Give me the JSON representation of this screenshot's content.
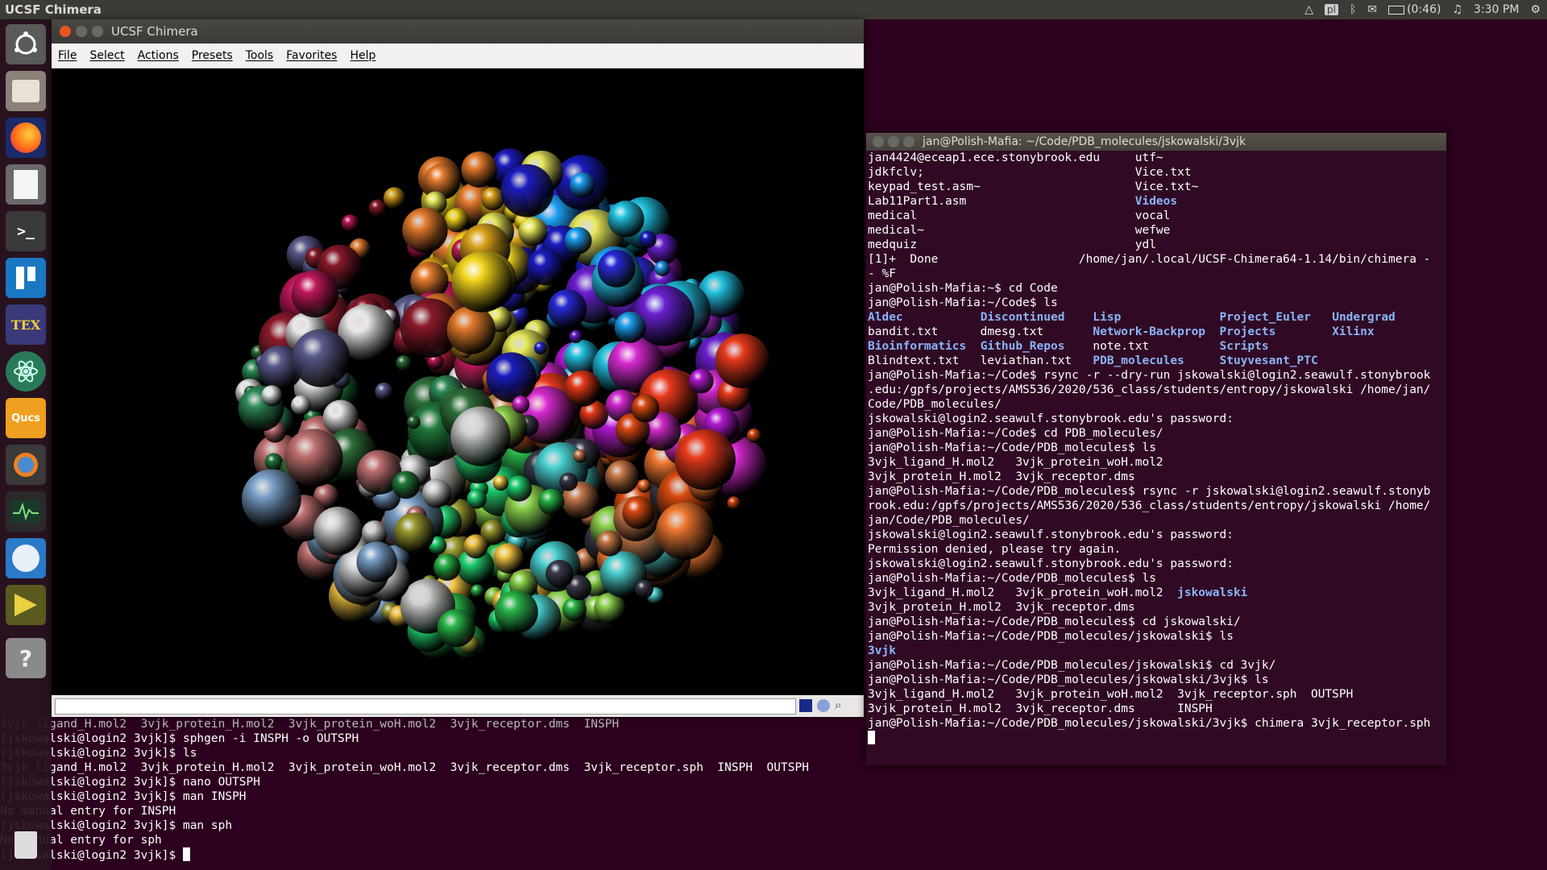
{
  "top_panel": {
    "title": "UCSF Chimera",
    "battery": "(0:46)",
    "clock": "3:30 PM"
  },
  "launcher": {
    "items": [
      "Ubuntu Dash",
      "Files",
      "Firefox",
      "Text Editor",
      "Terminal",
      "Trello",
      "TeXstudio",
      "Atom",
      "Qucs",
      "Blender",
      "System Monitor",
      "Arduino",
      "Xilinx",
      "Help",
      "Trash"
    ],
    "qucs_label": "Qucs",
    "tex_label": "TEX"
  },
  "chimera": {
    "title": "UCSF Chimera",
    "menu": [
      "File",
      "Select",
      "Actions",
      "Presets",
      "Tools",
      "Favorites",
      "Help"
    ],
    "sphere_colors": [
      "#1f7a3a",
      "#2e8b57",
      "#2f6f3a",
      "#e8e8e8",
      "#5a5a8c",
      "#8b1a2a",
      "#c0185a",
      "#e57c2e",
      "#d9a21b",
      "#f2d51d",
      "#e8e85a",
      "#1c1cc0",
      "#2a2ad8",
      "#1da1f2",
      "#22c3e0",
      "#6a1fd0",
      "#b51ad6",
      "#d62ad0",
      "#e83a1a",
      "#d84a10",
      "#f07830",
      "#c97a4a",
      "#3a3a4a",
      "#4ad1d1",
      "#8cd14a",
      "#2ab84a",
      "#20d070",
      "#f5c542",
      "#9a9a30",
      "#d0d0d0",
      "#7aa0c8",
      "#c07070"
    ]
  },
  "bg_terminal": {
    "lines": [
      "[jskowalski@login2 3vjk]$ sphgen -i INSPH -o OUTSPH",
      "[jskowalski@login2 3vjk]$ ls",
      "3vjk_ligand_H.mol2  3vjk_protein_H.mol2  3vjk_protein_woH.mol2  3vjk_receptor.dms  3vjk_receptor.sph  INSPH  OUTSPH",
      "[jskowalski@login2 3vjk]$ nano OUTSPH",
      "[jskowalski@login2 3vjk]$ man INSPH",
      "No manual entry for INSPH",
      "[jskowalski@login2 3vjk]$ man sph",
      "No manual entry for sph",
      "[jskowalski@login2 3vjk]$ "
    ],
    "partial_line": "3vjk_ligand_H.mol2  3vjk_protein_H.mol2  3vjk_protein_woH.mol2  3vjk_receptor.dms  INSPH"
  },
  "terminal": {
    "title": "jan@Polish-Mafia: ~/Code/PDB_molecules/jskowalski/3vjk",
    "rows": [
      [
        {
          "t": "jan4424@eceap1.ece.stonybrook.edu     utf~"
        }
      ],
      [
        {
          "t": "jdkfclv;                              Vice.txt"
        }
      ],
      [
        {
          "t": "keypad_test.asm~                      Vice.txt~"
        }
      ],
      [
        {
          "t": "Lab11Part1.asm                        "
        },
        {
          "t": "Videos",
          "c": "blue"
        }
      ],
      [
        {
          "t": "medical                               vocal"
        }
      ],
      [
        {
          "t": "medical~                              wefwe"
        }
      ],
      [
        {
          "t": "medquiz                               ydl"
        }
      ],
      [
        {
          "t": "[1]+  Done                    /home/jan/.local/UCSF-Chimera64-1.14/bin/chimera -"
        }
      ],
      [
        {
          "t": "- %F"
        }
      ],
      [
        {
          "t": "jan@Polish-Mafia:~$ cd Code"
        }
      ],
      [
        {
          "t": "jan@Polish-Mafia:~/Code$ ls"
        }
      ],
      [
        {
          "t": "Aldec",
          "c": "blue"
        },
        {
          "t": "           "
        },
        {
          "t": "Discontinued",
          "c": "blue"
        },
        {
          "t": "    "
        },
        {
          "t": "Lisp",
          "c": "blue"
        },
        {
          "t": "              "
        },
        {
          "t": "Project_Euler",
          "c": "blue"
        },
        {
          "t": "   "
        },
        {
          "t": "Undergrad",
          "c": "blue"
        }
      ],
      [
        {
          "t": "bandit.txt      dmesg.txt       "
        },
        {
          "t": "Network-Backprop",
          "c": "blue"
        },
        {
          "t": "  "
        },
        {
          "t": "Projects",
          "c": "blue"
        },
        {
          "t": "        "
        },
        {
          "t": "Xilinx",
          "c": "blue"
        }
      ],
      [
        {
          "t": "Bioinformatics",
          "c": "blue"
        },
        {
          "t": "  "
        },
        {
          "t": "Github_Repos",
          "c": "blue"
        },
        {
          "t": "    note.txt          "
        },
        {
          "t": "Scripts",
          "c": "blue"
        }
      ],
      [
        {
          "t": "Blindtext.txt   leviathan.txt   "
        },
        {
          "t": "PDB_molecules",
          "c": "blue"
        },
        {
          "t": "     "
        },
        {
          "t": "Stuyvesant_PTC",
          "c": "blue"
        }
      ],
      [
        {
          "t": "jan@Polish-Mafia:~/Code$ rsync -r --dry-run jskowalski@login2.seawulf.stonybrook"
        }
      ],
      [
        {
          "t": ".edu:/gpfs/projects/AMS536/2020/536_class/students/entropy/jskowalski /home/jan/"
        }
      ],
      [
        {
          "t": "Code/PDB_molecules/"
        }
      ],
      [
        {
          "t": "jskowalski@login2.seawulf.stonybrook.edu's password:"
        }
      ],
      [
        {
          "t": "jan@Polish-Mafia:~/Code$ cd PDB_molecules/"
        }
      ],
      [
        {
          "t": "jan@Polish-Mafia:~/Code/PDB_molecules$ ls"
        }
      ],
      [
        {
          "t": "3vjk_ligand_H.mol2   3vjk_protein_woH.mol2"
        }
      ],
      [
        {
          "t": "3vjk_protein_H.mol2  3vjk_receptor.dms"
        }
      ],
      [
        {
          "t": "jan@Polish-Mafia:~/Code/PDB_molecules$ rsync -r jskowalski@login2.seawulf.stonyb"
        }
      ],
      [
        {
          "t": "rook.edu:/gpfs/projects/AMS536/2020/536_class/students/entropy/jskowalski /home/"
        }
      ],
      [
        {
          "t": "jan/Code/PDB_molecules/"
        }
      ],
      [
        {
          "t": "jskowalski@login2.seawulf.stonybrook.edu's password:"
        }
      ],
      [
        {
          "t": "Permission denied, please try again."
        }
      ],
      [
        {
          "t": "jskowalski@login2.seawulf.stonybrook.edu's password:"
        }
      ],
      [
        {
          "t": "jan@Polish-Mafia:~/Code/PDB_molecules$ ls"
        }
      ],
      [
        {
          "t": "3vjk_ligand_H.mol2   3vjk_protein_woH.mol2  "
        },
        {
          "t": "jskowalski",
          "c": "blue"
        }
      ],
      [
        {
          "t": "3vjk_protein_H.mol2  3vjk_receptor.dms"
        }
      ],
      [
        {
          "t": "jan@Polish-Mafia:~/Code/PDB_molecules$ cd jskowalski/"
        }
      ],
      [
        {
          "t": "jan@Polish-Mafia:~/Code/PDB_molecules/jskowalski$ ls"
        }
      ],
      [
        {
          "t": "3vjk",
          "c": "blue"
        }
      ],
      [
        {
          "t": "jan@Polish-Mafia:~/Code/PDB_molecules/jskowalski$ cd 3vjk/"
        }
      ],
      [
        {
          "t": "jan@Polish-Mafia:~/Code/PDB_molecules/jskowalski/3vjk$ ls"
        }
      ],
      [
        {
          "t": "3vjk_ligand_H.mol2   3vjk_protein_woH.mol2  3vjk_receptor.sph  OUTSPH"
        }
      ],
      [
        {
          "t": "3vjk_protein_H.mol2  3vjk_receptor.dms      INSPH"
        }
      ],
      [
        {
          "t": "jan@Polish-Mafia:~/Code/PDB_molecules/jskowalski/3vjk$ chimera 3vjk_receptor.sph"
        }
      ],
      [
        {
          "t": ""
        }
      ]
    ]
  }
}
